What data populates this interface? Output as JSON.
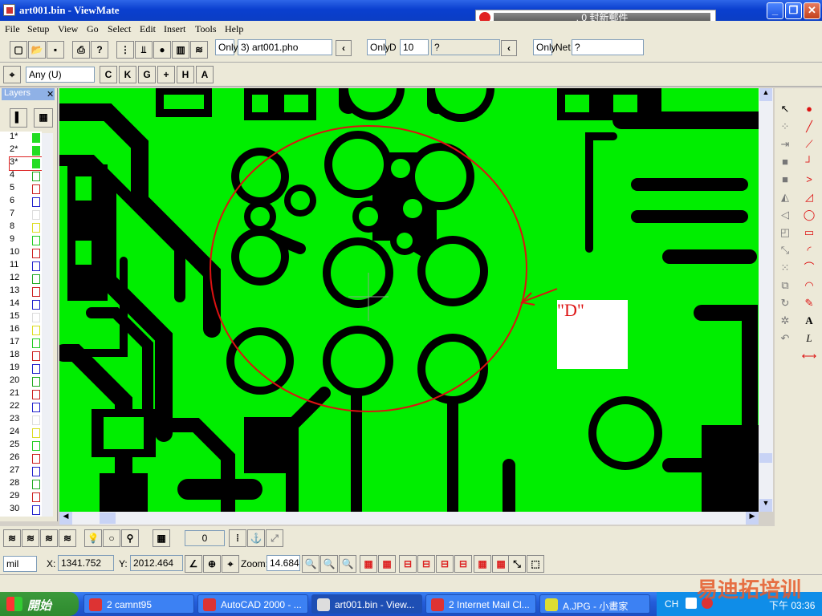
{
  "window": {
    "title": "art001.bin - ViewMate",
    "notification": ", 0 封新郵件"
  },
  "menu": [
    "File",
    "Setup",
    "View",
    "Go",
    "Select",
    "Edit",
    "Insert",
    "Tools",
    "Help"
  ],
  "toolbar1": {
    "only1": "Only",
    "layer_select": "3) art001.pho",
    "only2": "Only",
    "d_label": "D",
    "d_value": "10",
    "d_field": "?",
    "only3": "Only",
    "net_label": "Net",
    "net_value": "?"
  },
  "toolbar2": {
    "filter_select": "Any   (U)",
    "tool_letters": [
      "C",
      "K",
      "G",
      "+",
      "H",
      "A"
    ]
  },
  "layers": {
    "title": "Layers",
    "rows": [
      {
        "n": "1*",
        "c": "#22dd22",
        "f": true
      },
      {
        "n": "2*",
        "c": "#22dd22",
        "f": true
      },
      {
        "n": "3*",
        "c": "#22dd22",
        "f": true
      },
      {
        "n": "4",
        "c": "#22aa22",
        "f": false
      },
      {
        "n": "5",
        "c": "#cc2222",
        "f": false
      },
      {
        "n": "6",
        "c": "#2222cc",
        "f": false
      },
      {
        "n": "7",
        "c": "#dddddd",
        "f": false
      },
      {
        "n": "8",
        "c": "#dddd22",
        "f": false
      },
      {
        "n": "9",
        "c": "#22cc22",
        "f": false
      },
      {
        "n": "10",
        "c": "#cc2222",
        "f": false
      },
      {
        "n": "11",
        "c": "#2222cc",
        "f": false
      },
      {
        "n": "12",
        "c": "#22aa22",
        "f": false
      },
      {
        "n": "13",
        "c": "#cc2222",
        "f": false
      },
      {
        "n": "14",
        "c": "#2222cc",
        "f": false
      },
      {
        "n": "15",
        "c": "#dddddd",
        "f": false
      },
      {
        "n": "16",
        "c": "#dddd22",
        "f": false
      },
      {
        "n": "17",
        "c": "#22cc22",
        "f": false
      },
      {
        "n": "18",
        "c": "#cc2222",
        "f": false
      },
      {
        "n": "19",
        "c": "#2222cc",
        "f": false
      },
      {
        "n": "20",
        "c": "#22aa22",
        "f": false
      },
      {
        "n": "21",
        "c": "#cc2222",
        "f": false
      },
      {
        "n": "22",
        "c": "#2222cc",
        "f": false
      },
      {
        "n": "23",
        "c": "#dddddd",
        "f": false
      },
      {
        "n": "24",
        "c": "#dddd22",
        "f": false
      },
      {
        "n": "25",
        "c": "#22cc22",
        "f": false
      },
      {
        "n": "26",
        "c": "#cc2222",
        "f": false
      },
      {
        "n": "27",
        "c": "#2222cc",
        "f": false
      },
      {
        "n": "28",
        "c": "#22aa22",
        "f": false
      },
      {
        "n": "29",
        "c": "#cc2222",
        "f": false
      },
      {
        "n": "30",
        "c": "#2222cc",
        "f": false
      }
    ]
  },
  "annotation": {
    "label": "\"D\""
  },
  "bottom": {
    "counter": "0",
    "unit": "mil",
    "x_label": "X:",
    "x_value": "1341.752",
    "y_label": "Y:",
    "y_value": "2012.464",
    "zoom_label": "Zoom:",
    "zoom_value": "14.684"
  },
  "taskbar": {
    "start": "開始",
    "tasks": [
      "2 camnt95",
      "AutoCAD 2000 - ...",
      "art001.bin - View...",
      "2 Internet Mail Cl...",
      "A.JPG - 小畫家"
    ],
    "lang": "CH",
    "clock": "下午 03:36",
    "watermark": "易迪拓培训"
  },
  "colors": {
    "board": "#00ee00",
    "copper": "#000000",
    "annotation": "#dd1111"
  }
}
